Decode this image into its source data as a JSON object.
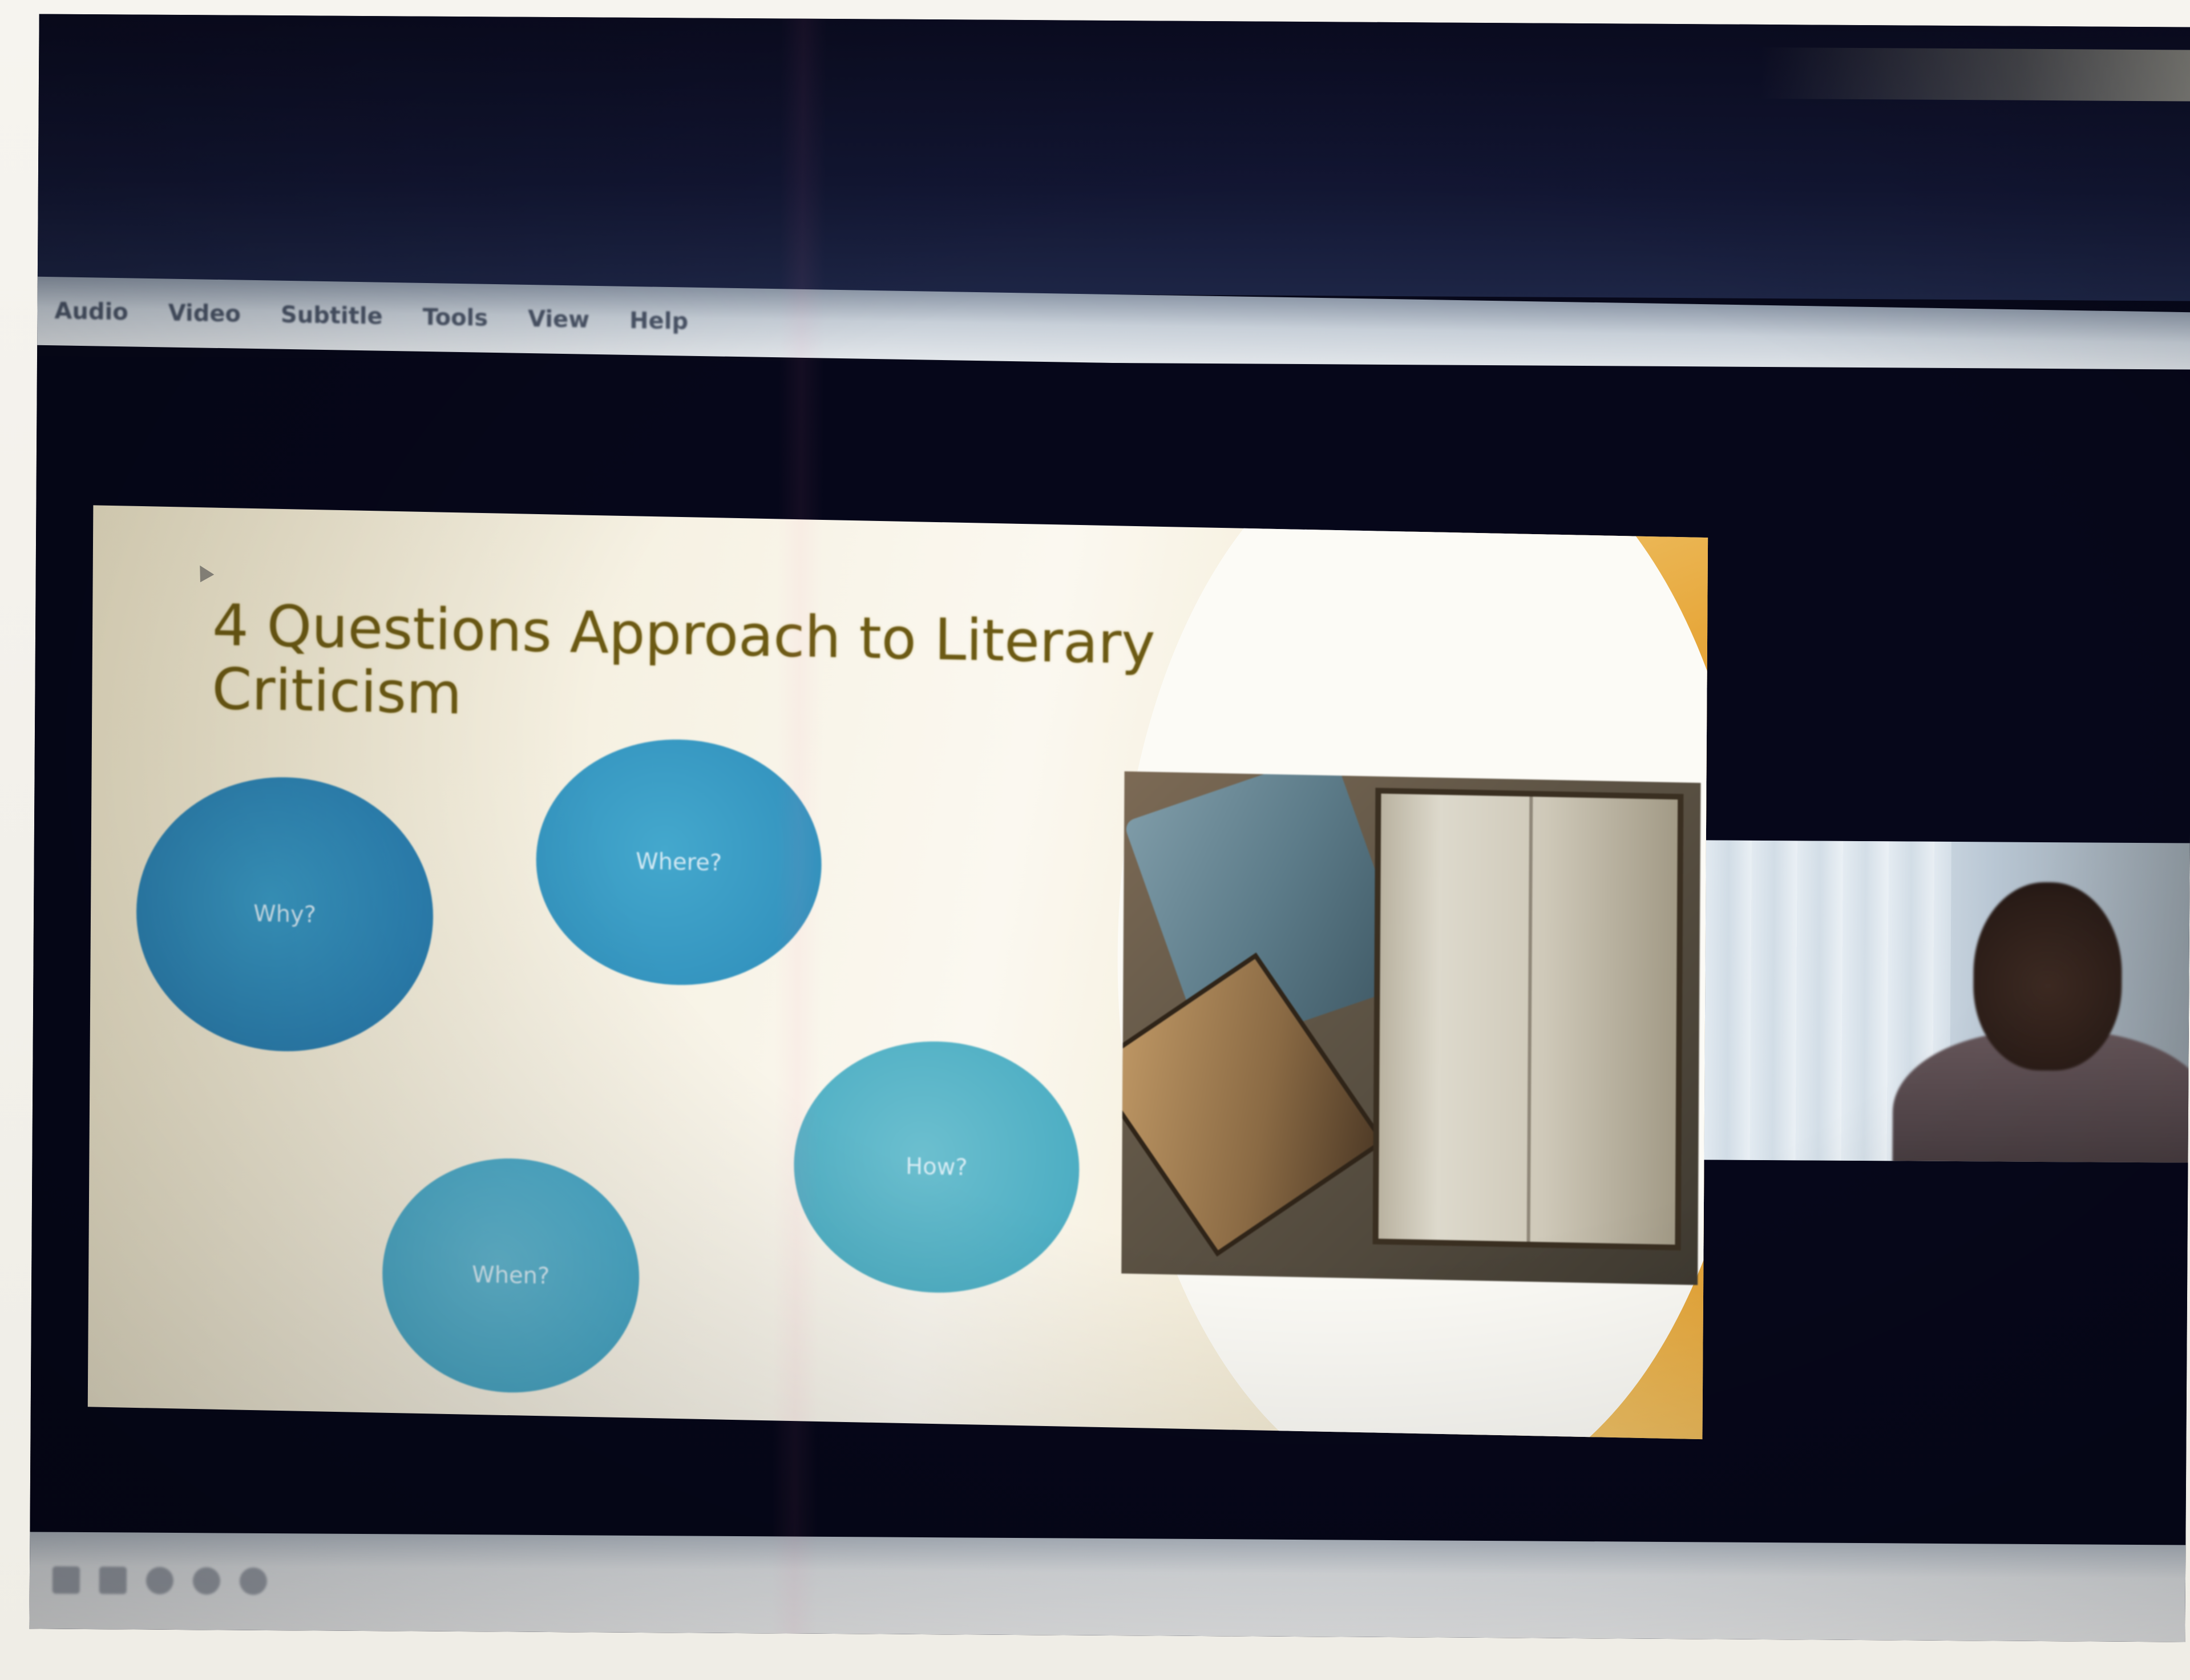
{
  "menu": {
    "items": [
      {
        "label": "Audio"
      },
      {
        "label": "Video"
      },
      {
        "label": "Subtitle"
      },
      {
        "label": "Tools"
      },
      {
        "label": "View"
      },
      {
        "label": "Help"
      }
    ]
  },
  "slide": {
    "title_line1": "4 Questions Approach to Literary",
    "title_line2": "Criticism",
    "circles": [
      {
        "label": "Why?"
      },
      {
        "label": "Where?"
      },
      {
        "label": "How?"
      },
      {
        "label": "When?"
      }
    ],
    "image_icon": "books-and-glasses-photo"
  },
  "video_tile": {
    "icon": "participant-video"
  },
  "colors": {
    "slide_accent": "#e7a83c",
    "circle_blue": "#2b7fb0",
    "circle_teal": "#4fafc4",
    "title_text": "#6c5a14"
  }
}
